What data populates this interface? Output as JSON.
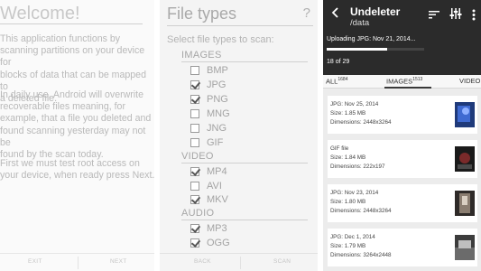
{
  "welcome": {
    "title": "Welcome!",
    "para1": "This application functions by\nscanning partitions on your device for\nblocks of data that can be mapped to\na deleted file.",
    "para2": "In daily use, Android will overwrite\nrecoverable files meaning, for\nexample, that a file you deleted and\nfound scanning yesterday may not be\nfound by the scan today.",
    "para3": "First we must test root access on\nyour device, when ready press Next.",
    "exit_label": "EXIT",
    "next_label": "NEXT"
  },
  "file_types": {
    "title": "File types",
    "help_icon": "?",
    "subtitle": "Select file types to scan:",
    "sections": {
      "images": "IMAGES",
      "video": "VIDEO",
      "audio": "AUDIO"
    },
    "items": [
      {
        "label": "BMP",
        "checked": false
      },
      {
        "label": "JPG",
        "checked": true
      },
      {
        "label": "PNG",
        "checked": true
      },
      {
        "label": "MNG",
        "checked": false
      },
      {
        "label": "JNG",
        "checked": false
      },
      {
        "label": "GIF",
        "checked": false
      },
      {
        "label": "MP4",
        "checked": true
      },
      {
        "label": "AVI",
        "checked": false
      },
      {
        "label": "MKV",
        "checked": true
      },
      {
        "label": "MP3",
        "checked": true
      },
      {
        "label": "OGG",
        "checked": true
      }
    ],
    "back_label": "BACK",
    "scan_label": "SCAN"
  },
  "undeleter": {
    "title": "Undeleter",
    "path": "/data",
    "upload_text": "Uploading JPG: Nov 21, 2014...",
    "progress": 0.62,
    "count_text": "18 of 29",
    "tabs": {
      "all": "ALL",
      "all_count": "1684",
      "images": "IMAGES",
      "images_count": "1513",
      "video": "VIDEO"
    },
    "files": [
      {
        "name": "JPG: Nov 25, 2014",
        "size": "Size: 1.85 MB",
        "dims": "Dimensions: 2448x3264"
      },
      {
        "name": "GIF file",
        "size": "Size: 1.84 MB",
        "dims": "Dimensions: 222x197"
      },
      {
        "name": "JPG: Nov 23, 2014",
        "size": "Size: 1.80 MB",
        "dims": "Dimensions: 2448x3264"
      },
      {
        "name": "JPG: Dec 1, 2014",
        "size": "Size: 1.79 MB",
        "dims": "Dimensions: 3264x2448"
      }
    ],
    "colors": {
      "appbar": "#2b2b2b",
      "accent": "#ffffff"
    }
  }
}
